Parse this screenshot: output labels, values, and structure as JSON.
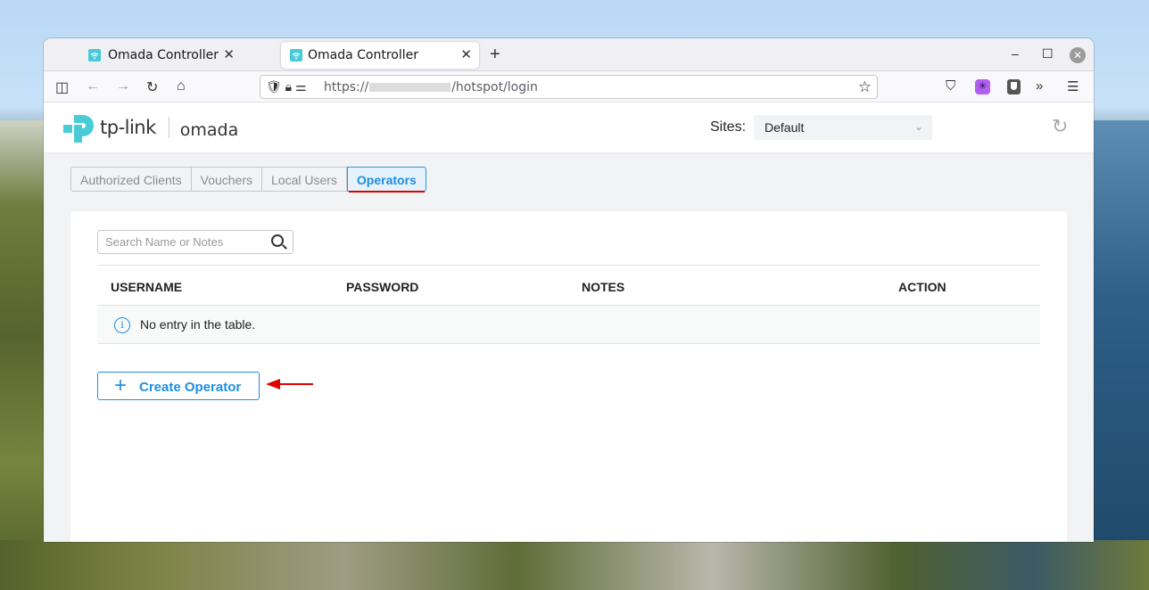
{
  "browser": {
    "tabs": [
      {
        "title": "Omada Controller",
        "active": false
      },
      {
        "title": "Omada Controller",
        "active": true
      }
    ],
    "new_tab_label": "+",
    "url_prefix": "https://",
    "url_path": "/hotspot/login",
    "window_controls": {
      "minimize": "–",
      "maximize": "☐",
      "close": "✕"
    }
  },
  "header": {
    "brand": "tp-link",
    "product": "omada",
    "sites_label": "Sites:",
    "sites_value": "Default"
  },
  "tabs": [
    {
      "label": "Authorized Clients",
      "active": false
    },
    {
      "label": "Vouchers",
      "active": false
    },
    {
      "label": "Local Users",
      "active": false
    },
    {
      "label": "Operators",
      "active": true
    }
  ],
  "search": {
    "placeholder": "Search Name or Notes",
    "value": ""
  },
  "table": {
    "columns": [
      "USERNAME",
      "PASSWORD",
      "NOTES",
      "ACTION"
    ],
    "empty_message": "No entry in the table.",
    "rows": []
  },
  "create_button": {
    "label": "Create Operator",
    "icon": "plus-icon"
  },
  "colors": {
    "accent": "#1f8fe0",
    "annotation": "#e00000",
    "favicon": "#48c9d8"
  }
}
